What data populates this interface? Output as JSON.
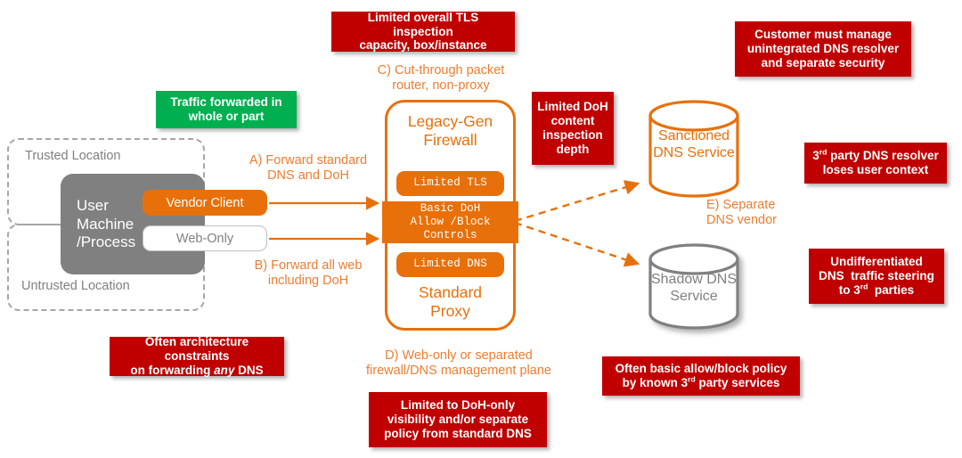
{
  "diagram": {
    "callouts": {
      "tls_capacity": "Limited overall TLS inspection capacity, box/instance",
      "traffic_forwarded": "Traffic forwarded in whole or part",
      "doh_depth": "Limited DoH content inspection depth",
      "customer_manage": "Customer must manage unintegrated DNS resolver and separate security",
      "third_party_context": "3rd party DNS resolver loses user context",
      "undifferentiated": "Undifferentiated DNS  traffic steering to 3rd  parties",
      "architecture_constraints": "Often architecture constraints on forwarding any DNS",
      "often_basic_policy": "Often basic allow/block policy by known 3rd party services",
      "doh_only_visibility": "Limited to DoH-only visibility and/or separate policy from standard DNS"
    },
    "zones": {
      "trusted": "Trusted Location",
      "untrusted": "Untrusted Location"
    },
    "machine": {
      "label": "User Machine /Process",
      "line1": "User",
      "line2": "Machine",
      "line3": "/Process",
      "vendor_client": "Vendor Client",
      "web_only": "Web-Only"
    },
    "annotations": {
      "a": "A) Forward standard DNS and DoH",
      "a_line1": "A) Forward standard",
      "a_line2": "DNS and DoH",
      "b": "B) Forward all web including DoH",
      "b_line1": "B) Forward all web",
      "b_line2": "including DoH",
      "c": "C) Cut-through packet router, non-proxy",
      "c_line1": "C) Cut-through packet",
      "c_line2": "router, non-proxy",
      "d": "D) Web-only or separated firewall/DNS management plane",
      "d_line1": "D) Web-only or separated",
      "d_line2": "firewall/DNS management plane",
      "e": "E) Separate DNS vendor",
      "e_line1": "E) Separate",
      "e_line2": "DNS vendor"
    },
    "firewall": {
      "top_title_line1": "Legacy-Gen",
      "top_title_line2": "Firewall",
      "chip_tls": "Limited TLS",
      "chip_doh_line1": "Basic DoH",
      "chip_doh_line2": "Allow /Block",
      "chip_doh_line3": "Controls",
      "chip_dns": "Limited DNS",
      "bottom_title_line1": "Standard",
      "bottom_title_line2": "Proxy"
    },
    "services": {
      "sanctioned_line1": "Sanctioned",
      "sanctioned_line2": "DNS Service",
      "shadow_line1": "Shadow DNS",
      "shadow_line2": "Service"
    },
    "colors": {
      "orange": "#E8700A",
      "orange_text": "#ED7D31",
      "red": "#C00000",
      "green": "#00B050",
      "grey": "#808080",
      "grey_light": "#A6A6A6"
    }
  }
}
